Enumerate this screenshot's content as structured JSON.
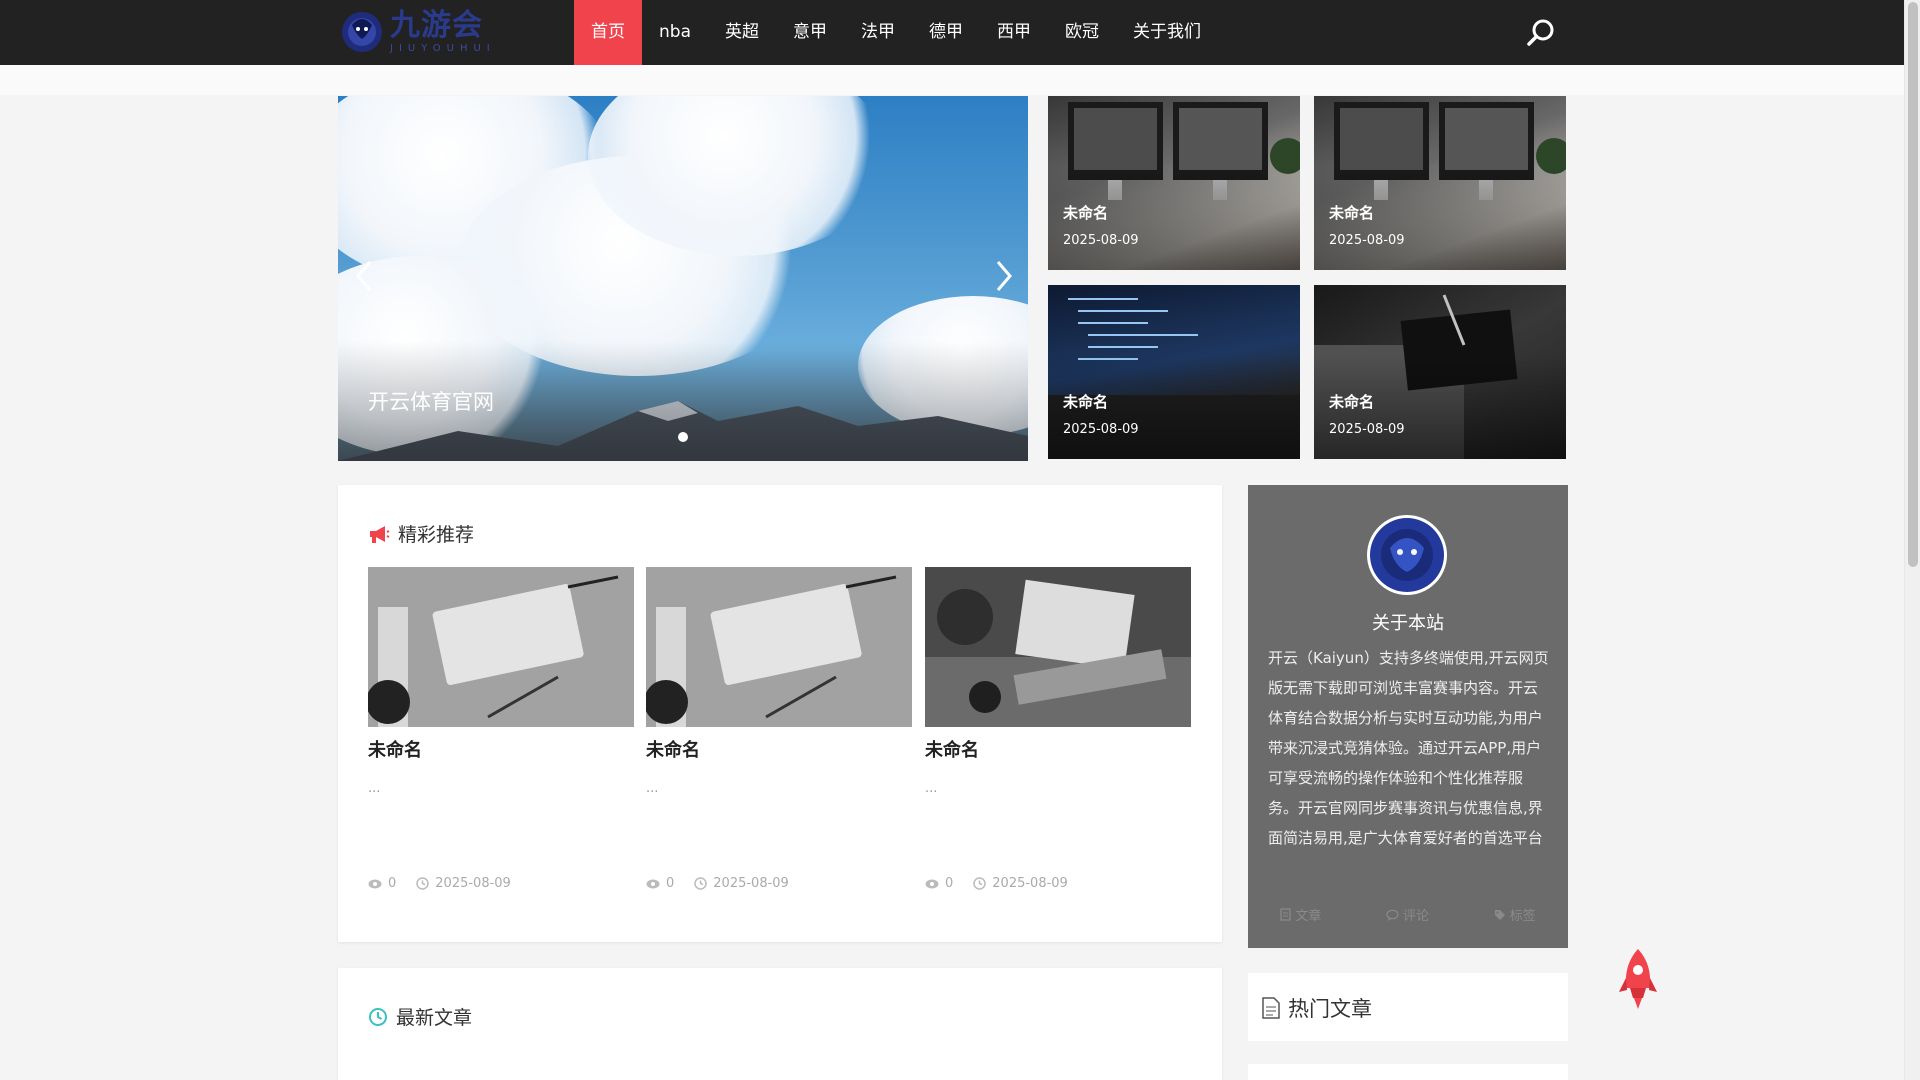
{
  "header": {
    "logo_text": "九游会",
    "logo_subtext": "JIUYOUHUI",
    "nav": [
      "首页",
      "nba",
      "英超",
      "意甲",
      "法甲",
      "德甲",
      "西甲",
      "欧冠",
      "关于我们"
    ],
    "active_nav": "首页"
  },
  "slider": {
    "caption": "开云体育官网",
    "slide_count": 1
  },
  "featured": [
    {
      "title": "未命名",
      "date": "2025-08-09"
    },
    {
      "title": "未命名",
      "date": "2025-08-09"
    },
    {
      "title": "未命名",
      "date": "2025-08-09"
    },
    {
      "title": "未命名",
      "date": "2025-08-09"
    }
  ],
  "recommend": {
    "title": "精彩推荐",
    "items": [
      {
        "title": "未命名",
        "excerpt": "...",
        "views": "0",
        "date": "2025-08-09"
      },
      {
        "title": "未命名",
        "excerpt": "...",
        "views": "0",
        "date": "2025-08-09"
      },
      {
        "title": "未命名",
        "excerpt": "...",
        "views": "0",
        "date": "2025-08-09"
      }
    ]
  },
  "latest": {
    "title": "最新文章"
  },
  "about": {
    "name": "关于本站",
    "description": "开云（Kaiyun）支持多终端使用,开云网页版无需下载即可浏览丰富赛事内容。开云体育结合数据分析与实时互动功能,为用户带来沉浸式竞猜体验。通过开云APP,用户可享受流畅的操作体验和个性化推荐服务。开云官网同步赛事资讯与优惠信息,界面简洁易用,是广大体育爱好者的首选平台",
    "stats": {
      "articles": "文章",
      "comments": "评论",
      "tags": "标签"
    }
  },
  "hot": {
    "title": "热门文章"
  },
  "colors": {
    "accent": "#f0434c",
    "header_bg": "#222222",
    "latest_icon": "#3cc0c0"
  }
}
